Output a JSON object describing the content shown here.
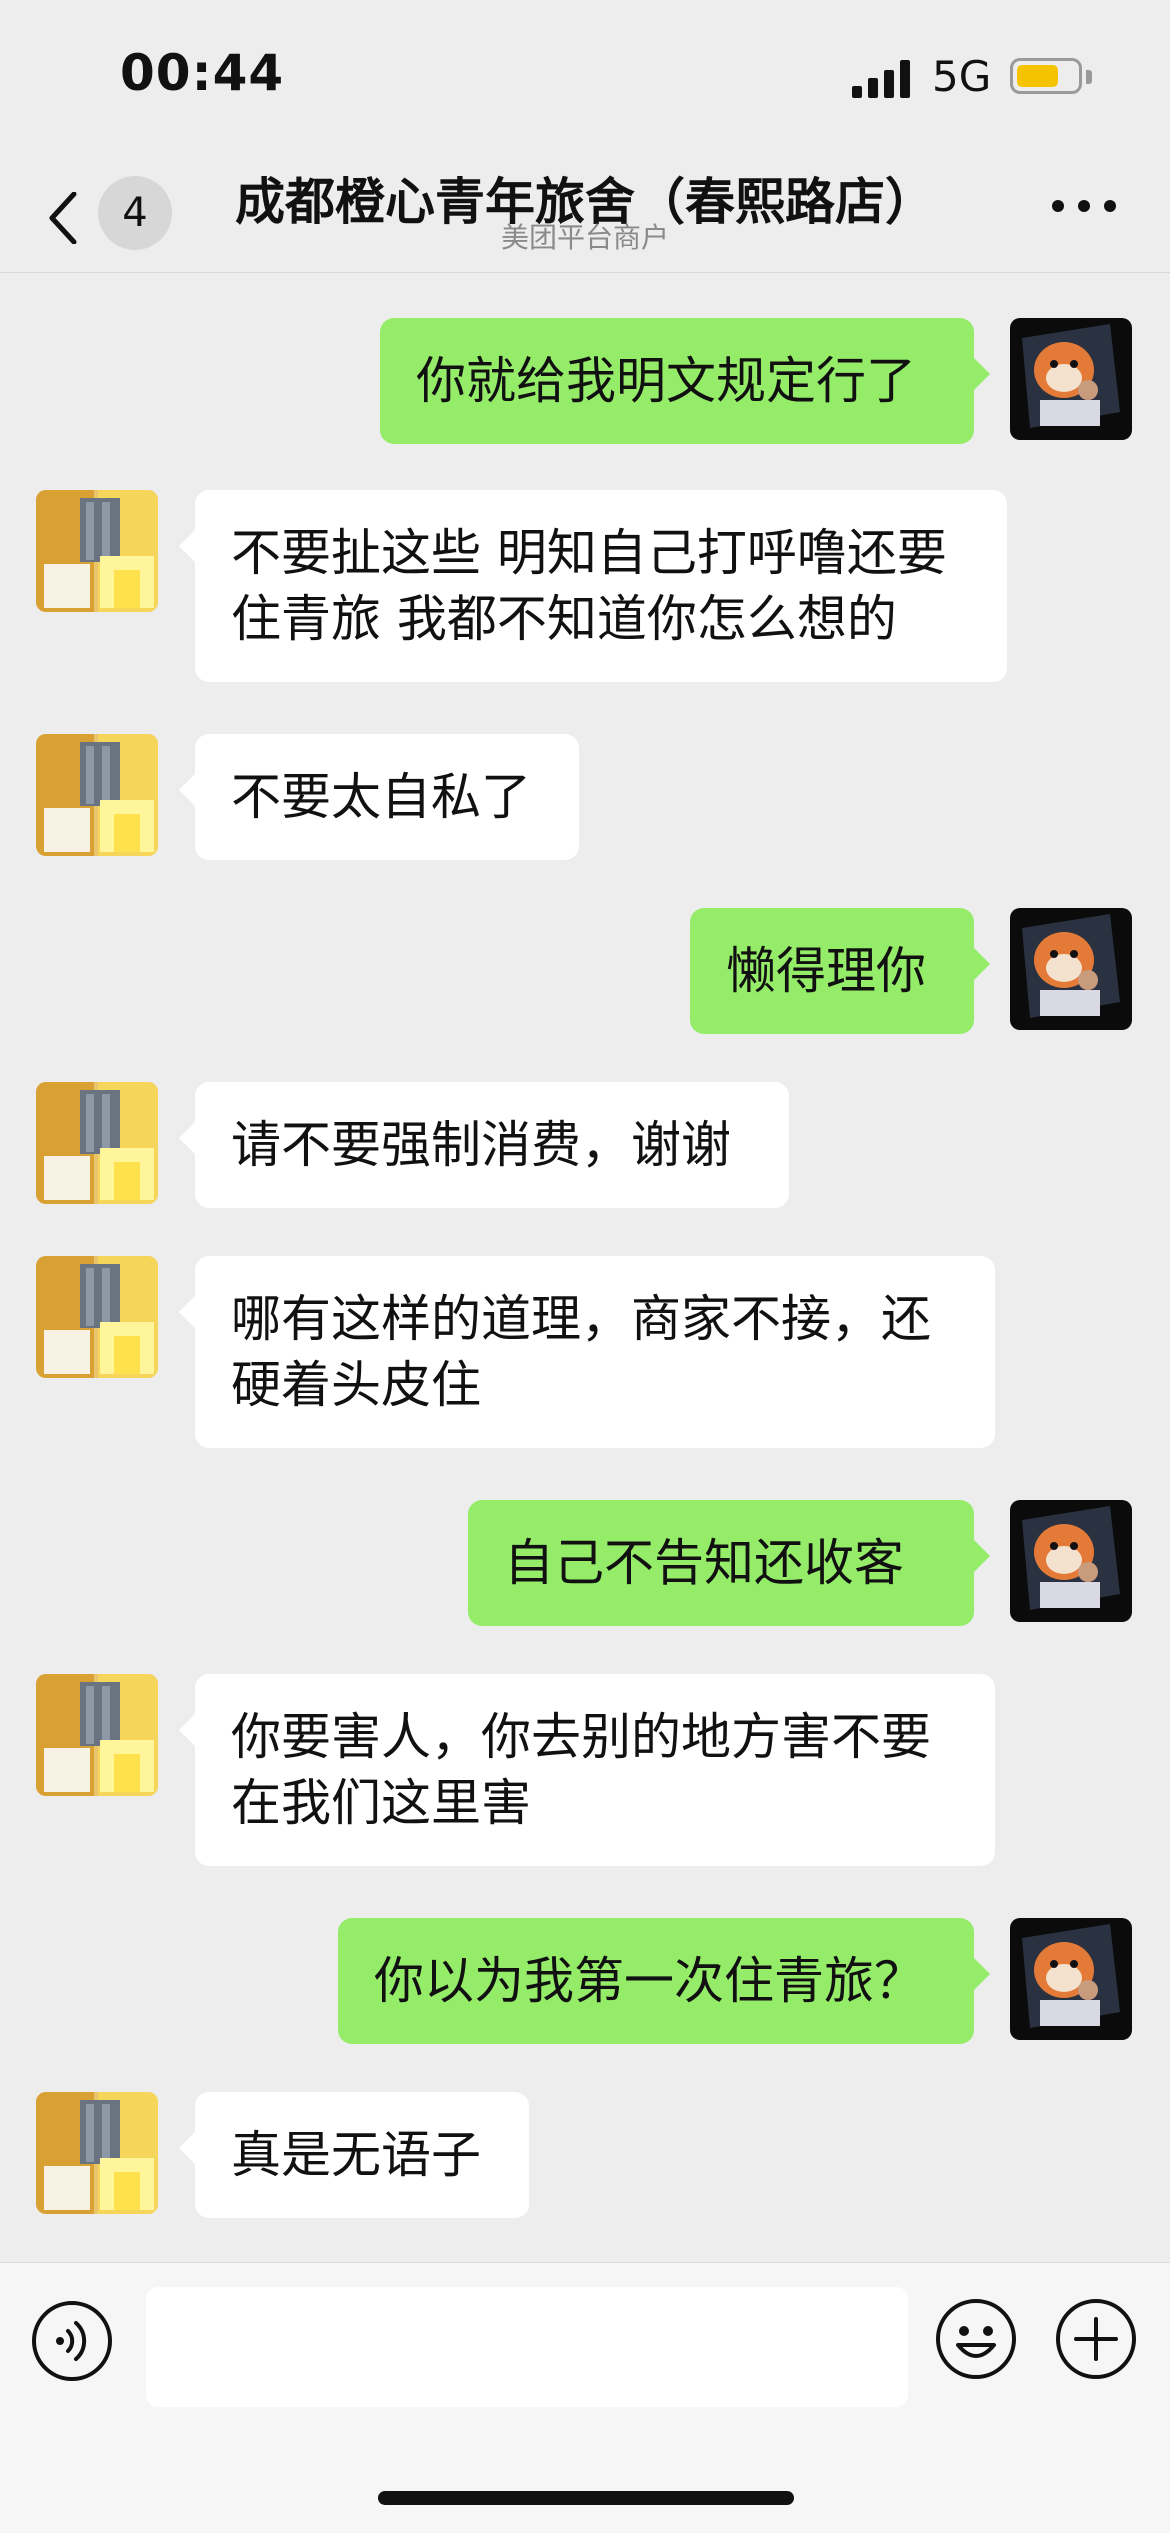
{
  "status_bar": {
    "time": "00:44",
    "network": "5G",
    "battery_level": 0.7,
    "battery_color": "#f5c400"
  },
  "header": {
    "unread_count": "4",
    "title": "成都橙心青年旅舍（春熙路店）",
    "subtitle": "美团平台商户"
  },
  "colors": {
    "outgoing_bubble": "#95ec69",
    "incoming_bubble": "#ffffff",
    "background": "#ededed"
  },
  "messages": [
    {
      "side": "out",
      "lines": [
        "你就给我明文规定行了"
      ]
    },
    {
      "side": "in",
      "lines": [
        "不要扯这些 明知自己打呼噜还要",
        "住青旅 我都不知道你怎么想的"
      ]
    },
    {
      "side": "in",
      "lines": [
        "不要太自私了"
      ]
    },
    {
      "side": "out",
      "lines": [
        "懒得理你"
      ]
    },
    {
      "side": "in",
      "lines": [
        "请不要强制消费，谢谢"
      ]
    },
    {
      "side": "in",
      "lines": [
        "哪有这样的道理，商家不接，还",
        "硬着头皮住"
      ]
    },
    {
      "side": "out",
      "lines": [
        "自己不告知还收客"
      ]
    },
    {
      "side": "in",
      "lines": [
        "你要害人，你去别的地方害不要",
        "在我们这里害"
      ]
    },
    {
      "side": "out",
      "lines": [
        "你以为我第一次住青旅？"
      ]
    },
    {
      "side": "in",
      "lines": [
        "真是无语子"
      ]
    }
  ],
  "input_bar": {
    "voice_icon": "voice-icon",
    "emoji_icon": "emoji-icon",
    "plus_icon": "plus-icon",
    "text": ""
  }
}
